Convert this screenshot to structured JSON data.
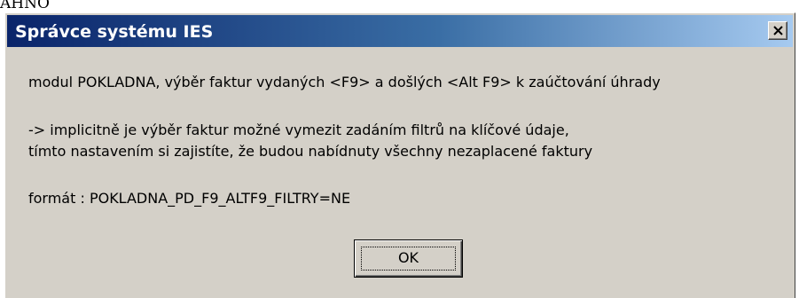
{
  "background_fragment": "ÁHNO",
  "dialog": {
    "title": "Správce systému IES",
    "close_glyph": "×",
    "message_lines": [
      "modul POKLADNA, výběr faktur vydaných <F9> a došlých <Alt F9> k zaúčtování úhrady",
      "-> implicitně je výběr faktur možné vymezit zadáním filtrů na klíčové údaje,",
      "tímto nastavením si zajistíte, že budou nabídnuty všechny nezaplacené faktury",
      "formát : POKLADNA_PD_F9_ALTF9_FILTRY=NE"
    ],
    "ok_label": "OK"
  },
  "colors": {
    "titlebar_start": "#0a246a",
    "titlebar_end": "#a6caf0",
    "face": "#d4d0c8"
  }
}
